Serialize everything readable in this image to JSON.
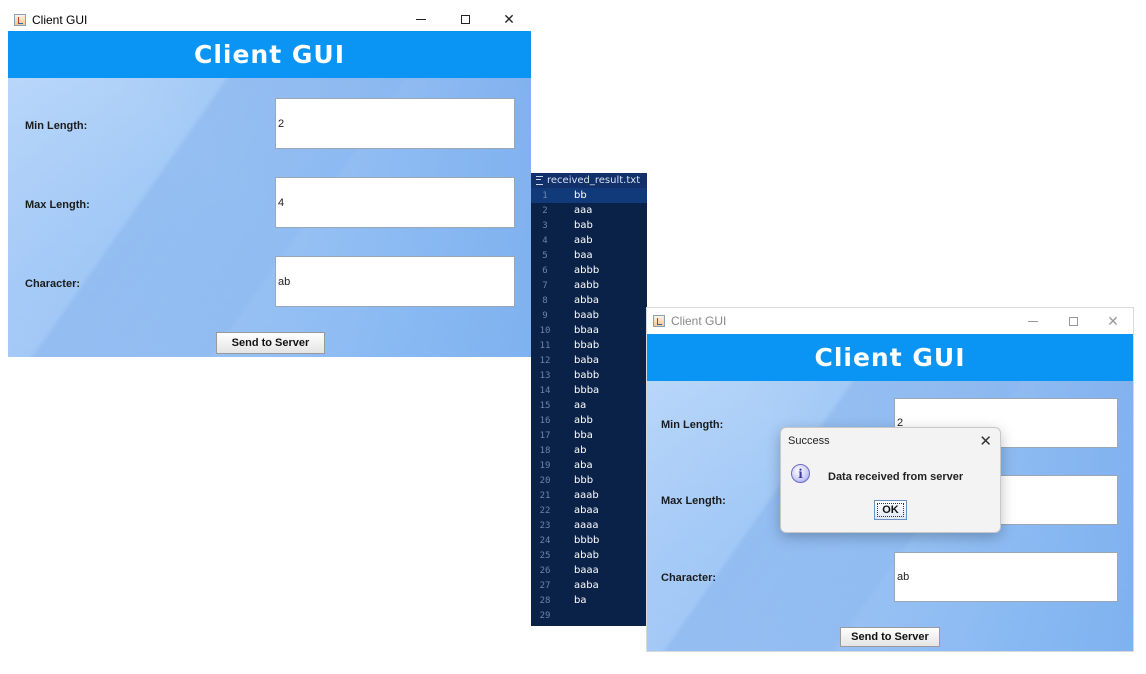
{
  "window1": {
    "title": "Client GUI",
    "banner": "Client GUI",
    "fields": [
      {
        "label": "Min Length:",
        "value": "2"
      },
      {
        "label": "Max Length:",
        "value": "4"
      },
      {
        "label": "Character:",
        "value": "ab"
      }
    ],
    "send_label": "Send to Server"
  },
  "editor": {
    "filename": "received_result.txt",
    "lines": [
      {
        "num": "1",
        "text": "bb"
      },
      {
        "num": "2",
        "text": "aaa"
      },
      {
        "num": "3",
        "text": "bab"
      },
      {
        "num": "4",
        "text": "aab"
      },
      {
        "num": "5",
        "text": "baa"
      },
      {
        "num": "6",
        "text": "abbb"
      },
      {
        "num": "7",
        "text": "aabb"
      },
      {
        "num": "8",
        "text": "abba"
      },
      {
        "num": "9",
        "text": "baab"
      },
      {
        "num": "10",
        "text": "bbaa"
      },
      {
        "num": "11",
        "text": "bbab"
      },
      {
        "num": "12",
        "text": "baba"
      },
      {
        "num": "13",
        "text": "babb"
      },
      {
        "num": "14",
        "text": "bbba"
      },
      {
        "num": "15",
        "text": "aa"
      },
      {
        "num": "16",
        "text": "abb"
      },
      {
        "num": "17",
        "text": "bba"
      },
      {
        "num": "18",
        "text": "ab"
      },
      {
        "num": "19",
        "text": "aba"
      },
      {
        "num": "20",
        "text": "bbb"
      },
      {
        "num": "21",
        "text": "aaab"
      },
      {
        "num": "22",
        "text": "abaa"
      },
      {
        "num": "23",
        "text": "aaaa"
      },
      {
        "num": "24",
        "text": "bbbb"
      },
      {
        "num": "25",
        "text": "abab"
      },
      {
        "num": "26",
        "text": "baaa"
      },
      {
        "num": "27",
        "text": "aaba"
      },
      {
        "num": "28",
        "text": "ba"
      },
      {
        "num": "29",
        "text": ""
      }
    ]
  },
  "window2": {
    "title": "Client GUI",
    "banner": "Client GUI",
    "fields": [
      {
        "label": "Min Length:",
        "value": "2"
      },
      {
        "label": "Max Length:",
        "value": ""
      },
      {
        "label": "Character:",
        "value": "ab"
      }
    ],
    "send_label": "Send to Server"
  },
  "dialog": {
    "title": "Success",
    "message": "Data received from server",
    "ok_label": "OK",
    "icon": "info-icon"
  },
  "colors": {
    "banner": "#0a95f5",
    "editor_bg": "#0b2248"
  }
}
